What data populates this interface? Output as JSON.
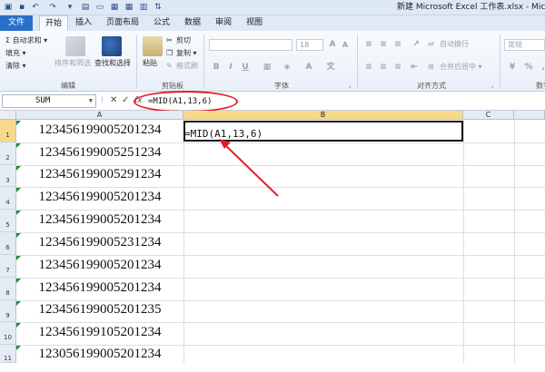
{
  "window": {
    "title": "新建 Microsoft Excel 工作表.xlsx - Microsc"
  },
  "tabs": [
    {
      "label": "文件"
    },
    {
      "label": "开始"
    },
    {
      "label": "插入"
    },
    {
      "label": "页面布局"
    },
    {
      "label": "公式"
    },
    {
      "label": "数据"
    },
    {
      "label": "审阅"
    },
    {
      "label": "视图"
    }
  ],
  "ribbon": {
    "editing": {
      "autosum": "Σ 自动求和 ▾",
      "fill": "填充 ▾",
      "clear": "清除 ▾",
      "sort_filter": "排序和筛选",
      "find_select": "查找和选择",
      "group_label": "编辑"
    },
    "clipboard": {
      "paste": "粘贴",
      "cut": "剪切",
      "copy": "复制 ▾",
      "format_painter": "格式刷",
      "group_label": "剪贴板"
    },
    "font": {
      "size": "18",
      "bold": "B",
      "italic": "I",
      "underline": "U",
      "group_label": "字体"
    },
    "alignment": {
      "wrap": "自动换行",
      "merge": "合并后居中 ▾",
      "group_label": "对齐方式"
    },
    "number": {
      "format": "常规",
      "group_label": "数字"
    }
  },
  "formula_bar": {
    "name_box": "SUM",
    "formula": "=MID(A1,13,6)"
  },
  "grid": {
    "columns": [
      "A",
      "B",
      "C"
    ],
    "rows": [
      {
        "num": "1",
        "a": "123456199005201234"
      },
      {
        "num": "2",
        "a": "123456199005251234"
      },
      {
        "num": "3",
        "a": "123456199005291234"
      },
      {
        "num": "4",
        "a": "123456199005201234"
      },
      {
        "num": "5",
        "a": "123456199005201234"
      },
      {
        "num": "6",
        "a": "123456199005231234"
      },
      {
        "num": "7",
        "a": "123456199005201234"
      },
      {
        "num": "8",
        "a": "123456199005201234"
      },
      {
        "num": "9",
        "a": "123456199005201235"
      },
      {
        "num": "10",
        "a": "123456199105201234"
      },
      {
        "num": "11",
        "a": "123056199005201234"
      }
    ],
    "b1_value": "=MID(A1,13,6)"
  },
  "colors": {
    "annotation": "#e0202a",
    "file_tab": "#2a6fc9",
    "selection_header": "#f8d88a"
  }
}
